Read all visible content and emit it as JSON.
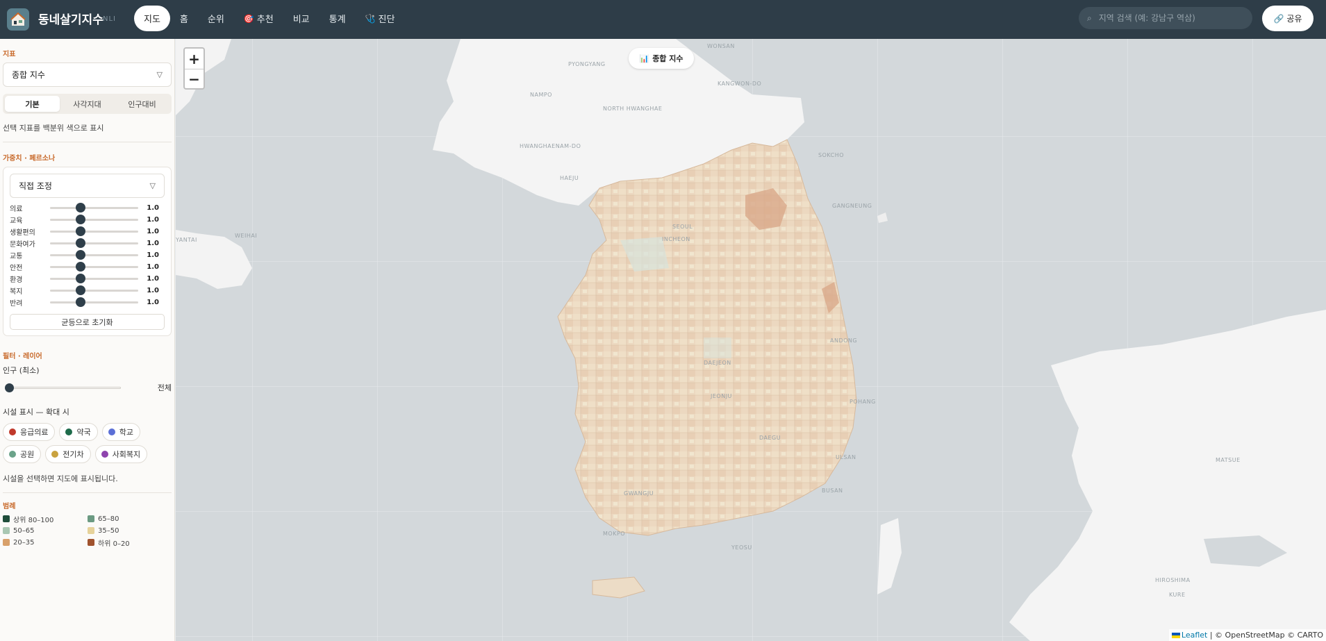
{
  "app": {
    "title": "동네살기지수",
    "subtitle": "NLI"
  },
  "nav": [
    {
      "label": "지도",
      "icon": "",
      "active": true
    },
    {
      "label": "홈",
      "icon": ""
    },
    {
      "label": "순위",
      "icon": ""
    },
    {
      "label": "추천",
      "icon": "🎯"
    },
    {
      "label": "비교",
      "icon": ""
    },
    {
      "label": "통계",
      "icon": ""
    },
    {
      "label": "진단",
      "icon": "🩺"
    }
  ],
  "search": {
    "placeholder": "지역 검색 (예: 강남구 역삼)"
  },
  "share": {
    "label": "공유",
    "icon": "link-icon"
  },
  "sidebar": {
    "metric_title": "지표",
    "metric_select": "종합 지수",
    "tabs": [
      "기본",
      "사각지대",
      "인구대비"
    ],
    "active_tab": "기본",
    "metric_note": "선택 지표를 백분위 색으로 표시",
    "weights_title": "가중치 · 페르소나",
    "persona_select": "직접 조정",
    "weights": [
      {
        "label": "의료",
        "value": "1.0",
        "level": 0.35
      },
      {
        "label": "교육",
        "value": "1.0",
        "level": 0.35
      },
      {
        "label": "생활편의",
        "value": "1.0",
        "level": 0.35
      },
      {
        "label": "문화여가",
        "value": "1.0",
        "level": 0.35
      },
      {
        "label": "교통",
        "value": "1.0",
        "level": 0.35
      },
      {
        "label": "안전",
        "value": "1.0",
        "level": 0.35
      },
      {
        "label": "환경",
        "value": "1.0",
        "level": 0.35
      },
      {
        "label": "복지",
        "value": "1.0",
        "level": 0.35
      },
      {
        "label": "반려",
        "value": "1.0",
        "level": 0.35
      }
    ],
    "reset_label": "균등으로 초기화",
    "filter_title": "필터 · 레이어",
    "population_label": "인구 (최소)",
    "population_value": "전체",
    "facility_label": "시설 표시 — 확대 시",
    "facilities": [
      {
        "label": "응급의료",
        "color": "#c0392b"
      },
      {
        "label": "약국",
        "color": "#1e6b4a"
      },
      {
        "label": "학교",
        "color": "#5b6fd6"
      },
      {
        "label": "공원",
        "color": "#6ba38a"
      },
      {
        "label": "전기차",
        "color": "#c9a23f"
      },
      {
        "label": "사회복지",
        "color": "#8e44ad"
      }
    ],
    "facility_note": "시설을 선택하면 지도에 표시됩니다.",
    "legend_title": "범례",
    "legend": [
      {
        "label": "상위 80–100",
        "color": "#1f4d3a"
      },
      {
        "label": "65–80",
        "color": "#6b9a82"
      },
      {
        "label": "50–65",
        "color": "#a9c7b2"
      },
      {
        "label": "35–50",
        "color": "#e6d29a"
      },
      {
        "label": "20–35",
        "color": "#d8a06a"
      },
      {
        "label": "하위 0–20",
        "color": "#a0522d"
      }
    ]
  },
  "map": {
    "metric_pill": "종합 지수",
    "zoom_in": "+",
    "zoom_out": "−",
    "attribution_leaflet": "Leaflet",
    "attribution_rest": "| © OpenStreetMap © CARTO",
    "labels": [
      "PYONGYANG",
      "WONSAN",
      "KANGWON-DO",
      "NAMPO",
      "NORTH HWANGHAE",
      "HWANGHAENAM-DO",
      "HAEJU",
      "SOKCHO",
      "GANGNEUNG",
      "SEOUL",
      "INCHEON",
      "ANDONG",
      "DAEJEON",
      "POHANG",
      "ULSAN",
      "BUSAN",
      "GWANGJU",
      "MOKPO",
      "YEOSU",
      "DAEGU",
      "JEONJU",
      "HIROSHIMA",
      "MATSUE",
      "KURE",
      "YANTAI",
      "WEIHAI"
    ]
  }
}
